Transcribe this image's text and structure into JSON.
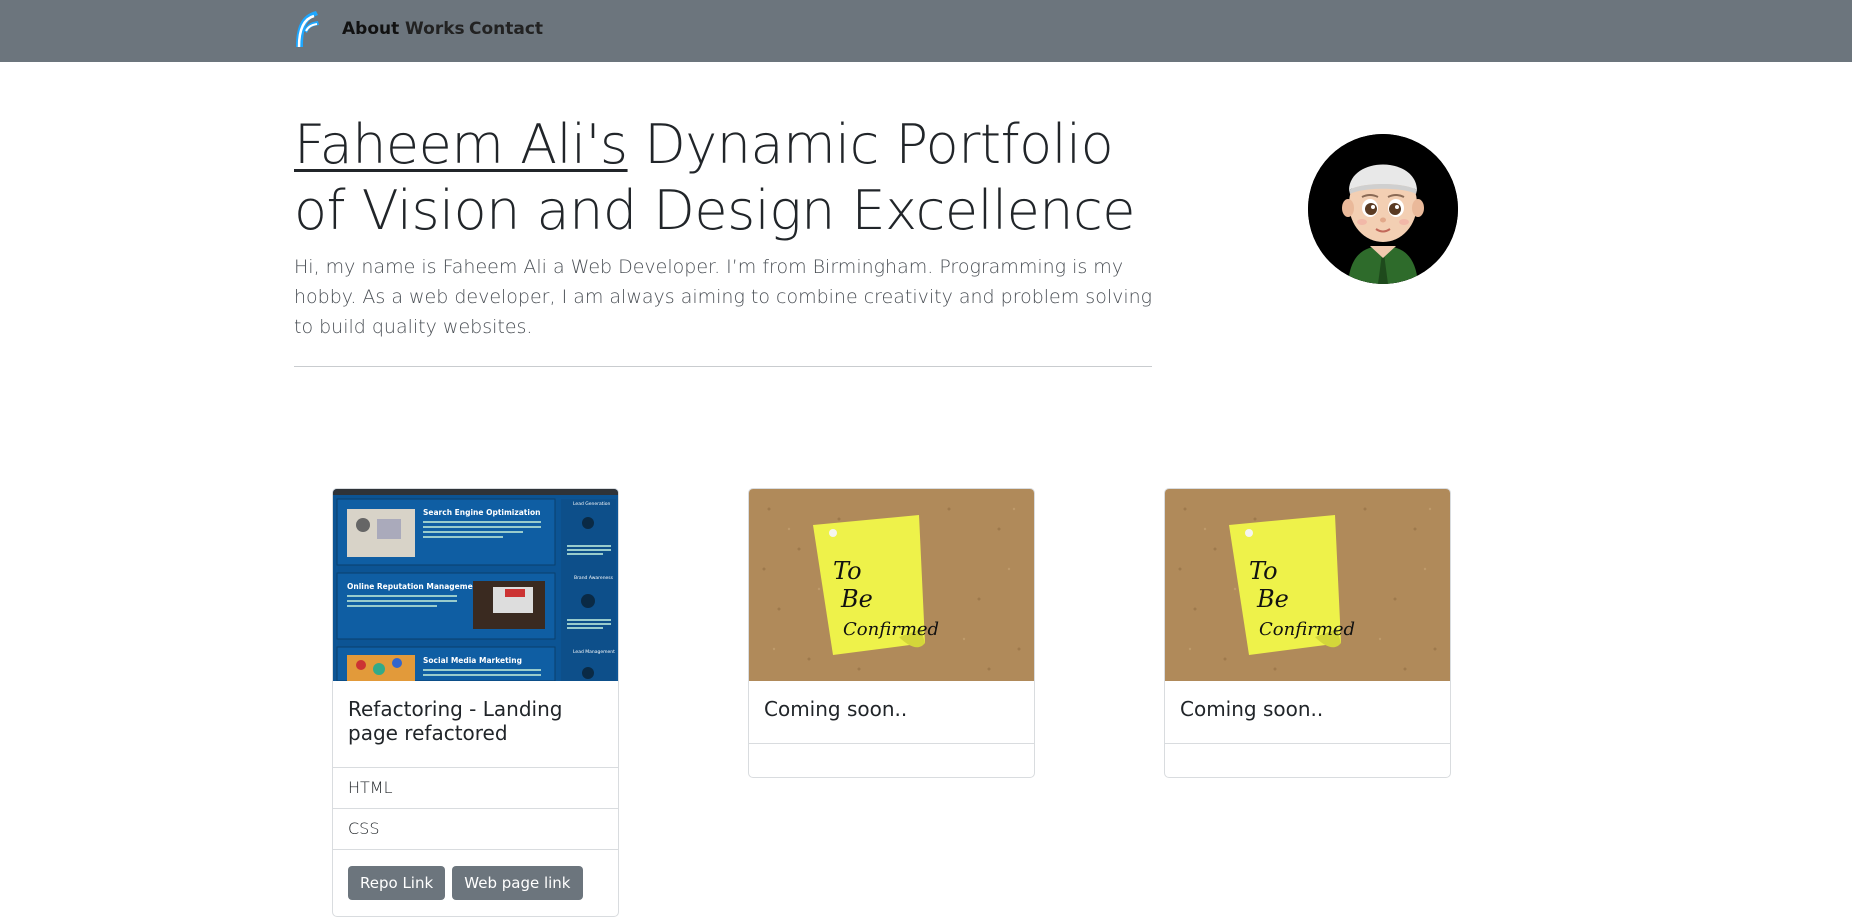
{
  "navbar": {
    "brand_icon": "f-logo-icon",
    "links": [
      {
        "label": "About",
        "active": true
      },
      {
        "label": "Works",
        "active": false
      },
      {
        "label": "Contact",
        "active": false
      }
    ]
  },
  "hero": {
    "title_name": "Faheem Ali's",
    "title_rest": " Dynamic Portfolio of Vision and Design Excellence",
    "lead": "Hi, my name is Faheem Ali a Web Developer. I’m from Birmingham. Programming is my hobby. As a web developer, I am always aiming to combine creativity and problem solving to build quality websites.",
    "avatar_icon": "cartoon-avatar-icon"
  },
  "cards": [
    {
      "title": "Refactoring - Landing page refactored",
      "image": "landing-page-screenshot",
      "list": [
        "HTML",
        "CSS"
      ],
      "buttons": [
        "Repo Link",
        "Web page link"
      ]
    },
    {
      "title": "Coming soon..",
      "image": "to-be-confirmed-note-image",
      "list": [],
      "buttons": []
    },
    {
      "title": "Coming soon..",
      "image": "to-be-confirmed-note-image",
      "list": [],
      "buttons": []
    }
  ],
  "thumbnail_text": {
    "seo": "Search Engine Optimization",
    "orm": "Online Reputation Management",
    "smm": "Social Media Marketing",
    "lead_gen": "Lead Generation",
    "brand": "Brand Awareness",
    "lead_mgmt": "Lead Management"
  },
  "note_text": {
    "line1": "To",
    "line2": "Be",
    "line3": "Confirmed"
  },
  "colors": {
    "navbar": "#6c757d",
    "button": "#6c757d",
    "thumb_blue": "#0c5494",
    "note_yellow": "#eef24a",
    "cork": "#b08a5a"
  }
}
